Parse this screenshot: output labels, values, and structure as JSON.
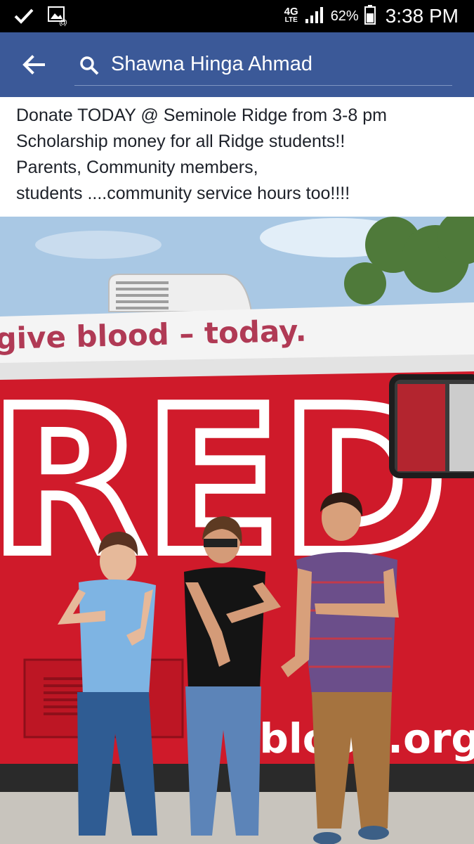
{
  "status_bar": {
    "network_type": "4G",
    "network_subtype": "LTE",
    "battery_percent": "62%",
    "time": "3:38 PM",
    "icons": [
      "check-icon",
      "image-notification-icon",
      "signal-icon",
      "battery-icon"
    ]
  },
  "app_bar": {
    "color": "#3b5998",
    "search_query": "Shawna Hinga Ahmad",
    "icons": [
      "back-arrow-icon",
      "search-icon"
    ]
  },
  "post": {
    "lines": [
      "Donate TODAY @ Seminole Ridge from 3-8 pm",
      "Scholarship money for all Ridge students!!",
      "Parents, Community members,",
      "students ....community service hours too!!!!"
    ]
  },
  "photo": {
    "bus_slogan": "give blood – today.",
    "bus_brand": "RED",
    "bus_url": "eblood.org",
    "colors": {
      "bus_red": "#cf1a2a",
      "slogan_color": "#b03a55",
      "sky": "#a9c8e4"
    }
  }
}
